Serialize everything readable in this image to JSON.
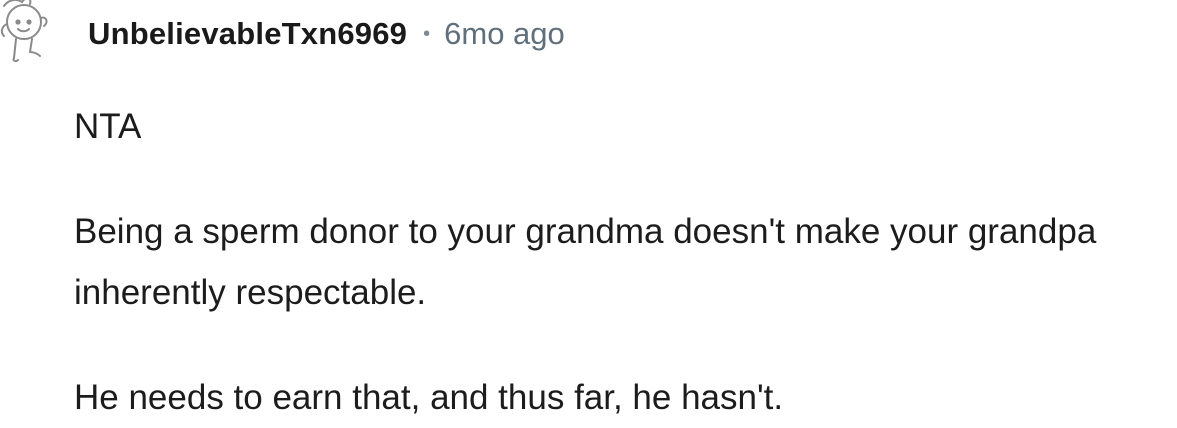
{
  "comment": {
    "username": "UnbelievableTxn6969",
    "separator": "•",
    "timestamp": "6mo ago",
    "avatar_icon": "snoo-avatar-icon",
    "paragraphs": [
      "NTA",
      "Being a sperm donor to your grandma doesn't make your grandpa inherently respectable.",
      "He needs to earn that, and thus far, he hasn't."
    ]
  },
  "colors": {
    "text": "#1c1c1c",
    "meta": "#5f6f7c"
  }
}
